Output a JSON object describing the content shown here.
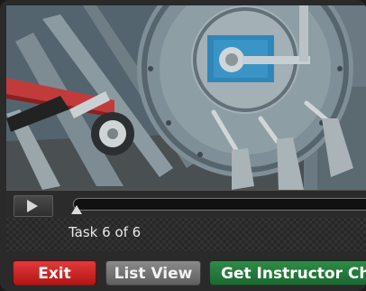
{
  "task": {
    "label": "Task 6 of 6"
  },
  "buttons": {
    "exit": "Exit",
    "list_view": "List View",
    "instructor_check": "Get Instructor Che"
  },
  "player": {
    "progress": 0.0,
    "state": "paused"
  },
  "colors": {
    "exit": "#d02525",
    "list_view": "#737373",
    "instructor_check": "#247a3c",
    "panel": "#2a2a2a"
  }
}
